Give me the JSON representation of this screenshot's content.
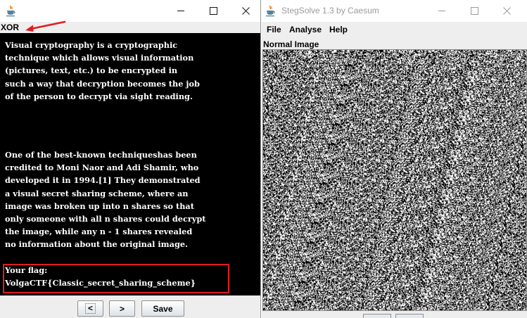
{
  "left_window": {
    "panel_title": "XOR",
    "text": {
      "paragraph1": [
        "Visual cryptography is a cryptographic",
        "technique which allows visual information",
        "(pictures, text, etc.) to be encrypted in",
        "such a way that decryption becomes the job",
        "of the person to decrypt via sight reading."
      ],
      "paragraph2": [
        "One of the best-known techniqueshas been",
        "credited to Moni Naor and Adi Shamir, who",
        "developed it in 1994.[1] They demonstrated",
        "a visual secret sharing scheme, where an",
        "image was broken up into n shares so that",
        "only someone with all n shares could decrypt",
        "the image, while any n - 1 shares revealed",
        "no information about the original image."
      ],
      "flag_label": "Your flag:",
      "flag_value": "VolgaCTF{Classic_secret_sharing_scheme}"
    },
    "buttons": {
      "prev": "<",
      "next": ">",
      "save": "Save"
    },
    "annotation_color": "#e11b22"
  },
  "right_window": {
    "title": "StegSolve 1.3 by Caesum",
    "menu": [
      "File",
      "Analyse",
      "Help"
    ],
    "image_label": "Normal Image"
  },
  "icons": {
    "app_icon": "java-cup-icon",
    "minimize": "minimize-icon",
    "maximize": "maximize-icon",
    "close": "close-icon"
  }
}
